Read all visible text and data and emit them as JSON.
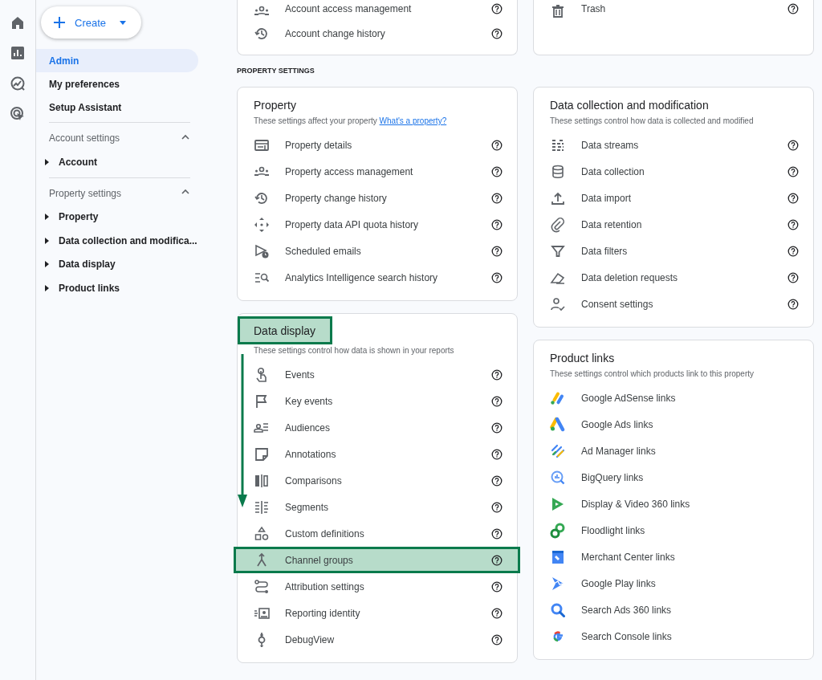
{
  "sidebar": {
    "create_button": {
      "label": "Create"
    },
    "items": [
      {
        "label": "Admin",
        "selected": true
      },
      {
        "label": "My preferences",
        "selected": false
      },
      {
        "label": "Setup Assistant",
        "selected": false
      }
    ],
    "sections": [
      {
        "title": "Account settings",
        "expanded": true,
        "children": [
          {
            "label": "Account",
            "expanded": false
          }
        ]
      },
      {
        "title": "Property settings",
        "expanded": true,
        "children": [
          {
            "label": "Property",
            "expanded": false
          },
          {
            "label": "Data collection and modifica...",
            "expanded": false
          },
          {
            "label": "Data display",
            "expanded": false
          },
          {
            "label": "Product links",
            "expanded": false
          }
        ]
      }
    ]
  },
  "main": {
    "top_cards": [
      {
        "items": [
          {
            "label": "Account access management",
            "highlighted": false,
            "help": true
          },
          {
            "label": "Account change history",
            "highlighted": false,
            "help": true
          }
        ]
      },
      {
        "items": [
          {
            "label": "Trash",
            "highlighted": false,
            "help": true
          }
        ]
      }
    ],
    "section_heading": "PROPERTY SETTINGS",
    "columns": [
      [
        {
          "title": "Property",
          "title_highlighted": false,
          "description": "These settings affect your property",
          "link": "What's a property?",
          "items": [
            {
              "label": "Property details",
              "highlighted": false,
              "help": true
            },
            {
              "label": "Property access management",
              "highlighted": false,
              "help": true
            },
            {
              "label": "Property change history",
              "highlighted": false,
              "help": true
            },
            {
              "label": "Property data API quota history",
              "highlighted": false,
              "help": true
            },
            {
              "label": "Scheduled emails",
              "highlighted": false,
              "help": true
            },
            {
              "label": "Analytics Intelligence search history",
              "highlighted": false,
              "help": true
            }
          ]
        },
        {
          "title": "Data display",
          "title_highlighted": true,
          "description": "These settings control how data is shown in your reports",
          "items": [
            {
              "label": "Events",
              "highlighted": false,
              "help": true
            },
            {
              "label": "Key events",
              "highlighted": false,
              "help": true
            },
            {
              "label": "Audiences",
              "highlighted": false,
              "help": true
            },
            {
              "label": "Annotations",
              "highlighted": false,
              "help": true
            },
            {
              "label": "Comparisons",
              "highlighted": false,
              "help": true
            },
            {
              "label": "Segments",
              "highlighted": false,
              "help": true
            },
            {
              "label": "Custom definitions",
              "highlighted": false,
              "help": true
            },
            {
              "label": "Channel groups",
              "highlighted": true,
              "help": true
            },
            {
              "label": "Attribution settings",
              "highlighted": false,
              "help": true
            },
            {
              "label": "Reporting identity",
              "highlighted": false,
              "help": true
            },
            {
              "label": "DebugView",
              "highlighted": false,
              "help": true
            }
          ]
        }
      ],
      [
        {
          "title": "Data collection and modification",
          "title_highlighted": false,
          "description": "These settings control how data is collected and modified",
          "items": [
            {
              "label": "Data streams",
              "highlighted": false,
              "help": true
            },
            {
              "label": "Data collection",
              "highlighted": false,
              "help": true
            },
            {
              "label": "Data import",
              "highlighted": false,
              "help": true
            },
            {
              "label": "Data retention",
              "highlighted": false,
              "help": true
            },
            {
              "label": "Data filters",
              "highlighted": false,
              "help": true
            },
            {
              "label": "Data deletion requests",
              "highlighted": false,
              "help": true
            },
            {
              "label": "Consent settings",
              "highlighted": false,
              "help": true
            }
          ]
        },
        {
          "title": "Product links",
          "title_highlighted": false,
          "description": "These settings control which products link to this property",
          "items": [
            {
              "label": "Google AdSense links",
              "highlighted": false,
              "help": false
            },
            {
              "label": "Google Ads links",
              "highlighted": false,
              "help": false
            },
            {
              "label": "Ad Manager links",
              "highlighted": false,
              "help": false
            },
            {
              "label": "BigQuery links",
              "highlighted": false,
              "help": false
            },
            {
              "label": "Display & Video 360 links",
              "highlighted": false,
              "help": false
            },
            {
              "label": "Floodlight links",
              "highlighted": false,
              "help": false
            },
            {
              "label": "Merchant Center links",
              "highlighted": false,
              "help": false
            },
            {
              "label": "Google Play links",
              "highlighted": false,
              "help": false
            },
            {
              "label": "Search Ads 360 links",
              "highlighted": false,
              "help": false
            },
            {
              "label": "Search Console links",
              "highlighted": false,
              "help": false
            }
          ]
        }
      ]
    ]
  }
}
